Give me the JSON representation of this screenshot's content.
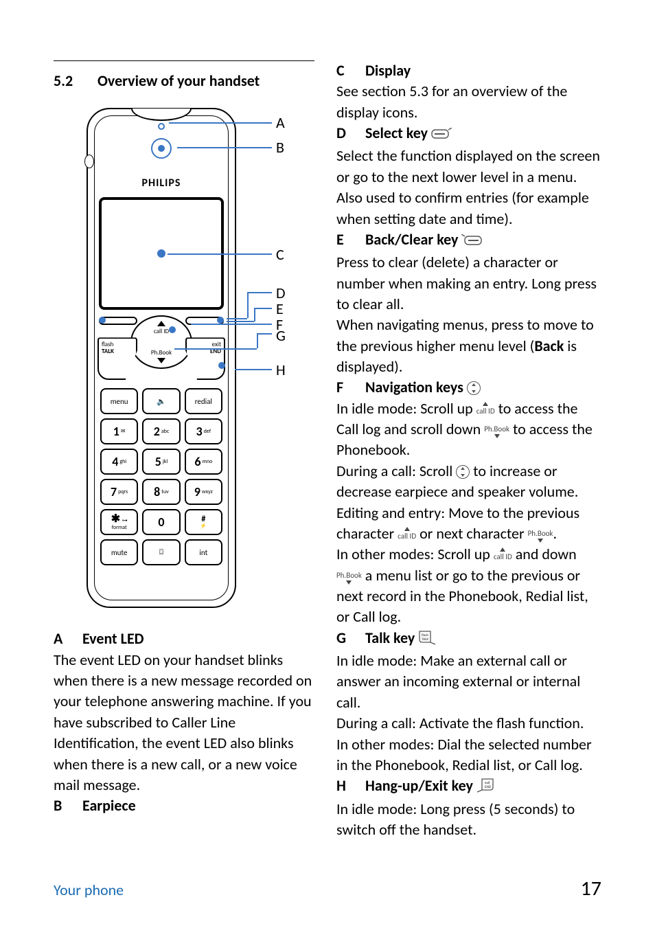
{
  "section": {
    "number": "5.2",
    "title": "Overview of your handset"
  },
  "diagram": {
    "brand": "PHILIPS",
    "nav": {
      "top": "call ID",
      "bottom": "Ph.Book"
    },
    "sidekeys": {
      "left": {
        "line1": "flash",
        "line2": "TALK"
      },
      "right": {
        "line1": "exit",
        "line2": "END"
      }
    },
    "keys": {
      "menu": "menu",
      "speaker": "🔈",
      "redial": "redial",
      "k1": "1",
      "k1sub": "✉",
      "k2": "2",
      "k2sub": "abc",
      "k3": "3",
      "k3sub": "def",
      "k4": "4",
      "k4sub": "ghi",
      "k5": "5",
      "k5sub": "jkl",
      "k6": "6",
      "k6sub": "mno",
      "k7": "7",
      "k7sub": "pqrs",
      "k8": "8",
      "k8sub": "tuv",
      "k9": "9",
      "k9sub": "wxyz",
      "star": "✱",
      "starsub1": "⊶",
      "starsub2": "format",
      "k0": "0",
      "hash1": "#",
      "hash2": "⚡",
      "mute": "mute",
      "tape": "⌼",
      "int": "int"
    },
    "callouts": {
      "A": "A",
      "B": "B",
      "C": "C",
      "D": "D",
      "E": "E",
      "F": "F",
      "G": "G",
      "H": "H"
    }
  },
  "left": {
    "A": {
      "letter": "A",
      "title": "Event LED",
      "body": "The event LED on your handset blinks when there is a new message recorded on your telephone answering machine. If you have subscribed to Caller Line Identification, the event LED also blinks when there is a new call, or a new voice mail message."
    },
    "B": {
      "letter": "B",
      "title": "Earpiece"
    }
  },
  "right": {
    "C": {
      "letter": "C",
      "title": "Display",
      "body": "See section 5.3 for an overview of the display icons."
    },
    "D": {
      "letter": "D",
      "title": "Select key",
      "body": "Select the function displayed on the screen or go to the next lower level in a menu. Also used to confirm entries (for example when setting date and time)."
    },
    "E": {
      "letter": "E",
      "title": "Back/Clear key",
      "body1": "Press to clear (delete) a character or number when making an entry. Long press to clear all.",
      "body2a": "When navigating menus, press to move to the previous higher menu level (",
      "body2bold": "Back",
      "body2b": " is displayed)."
    },
    "F": {
      "letter": "F",
      "title": "Navigation keys",
      "p1a": "In idle mode: Scroll up ",
      "p1b": " to access the Call log and scroll down ",
      "p1c": " to access the Phonebook.",
      "p2a": "During a call: Scroll ",
      "p2b": " to increase or decrease earpiece and speaker volume.",
      "p3a": "Editing and entry: Move to the previous character ",
      "p3b": " or next character ",
      "p3c": ".",
      "p4a": "In other modes: Scroll up ",
      "p4b": " and down ",
      "p4c": " a menu list or go to the previous or next record in the Phonebook, Redial list, or Call log."
    },
    "G": {
      "letter": "G",
      "title": "Talk key",
      "p1": "In idle mode: Make an external call or answer an incoming external or internal call.",
      "p2": "During a call: Activate the flash function.",
      "p3": "In other modes: Dial the selected number in the Phonebook, Redial list, or Call log."
    },
    "H": {
      "letter": "H",
      "title": "Hang-up/Exit key",
      "p1": "In idle mode: Long press (5 seconds) to switch off the handset."
    },
    "icons": {
      "callid": "call ID",
      "phbook": "Ph.Book"
    }
  },
  "footer": {
    "label": "Your phone",
    "page": "17"
  }
}
